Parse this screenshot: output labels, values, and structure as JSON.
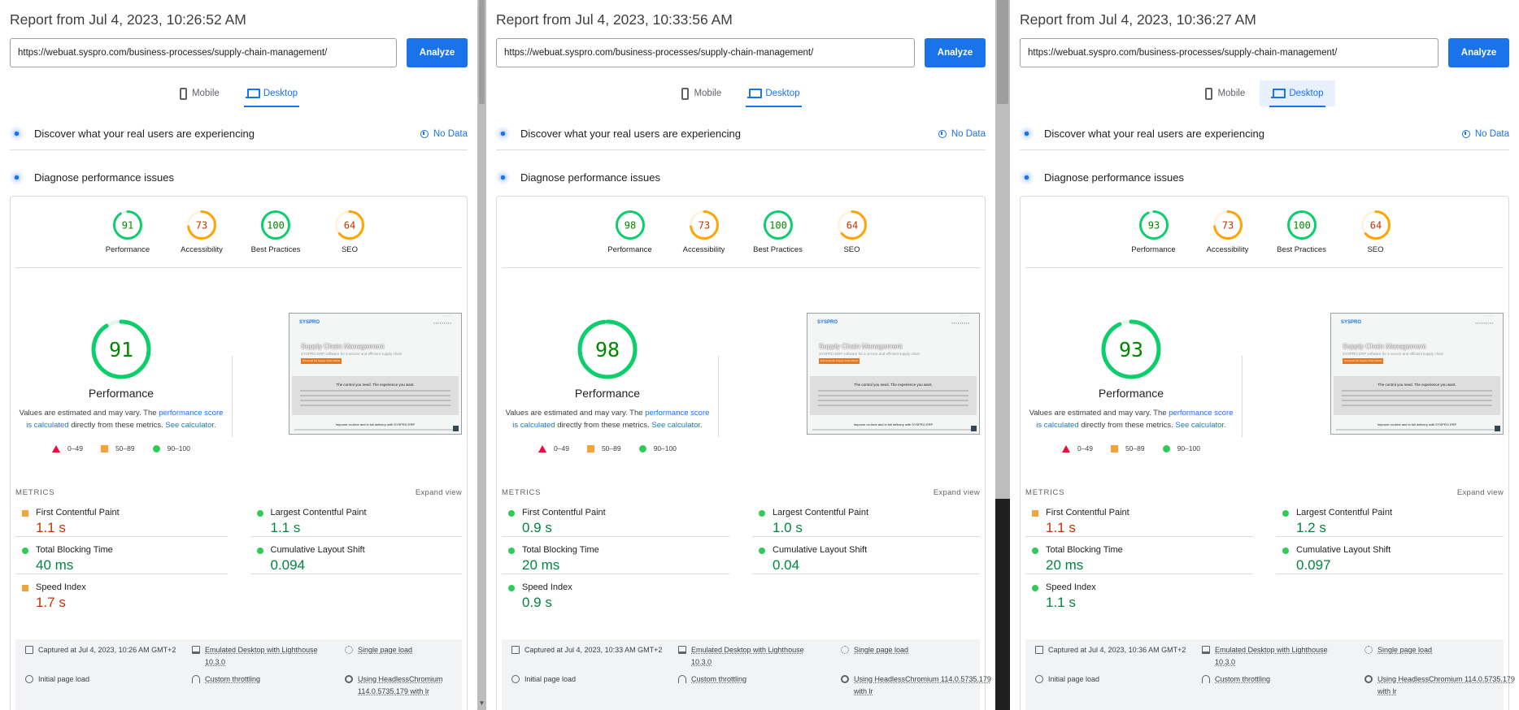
{
  "shared": {
    "analyze_label": "Analyze",
    "tab_mobile": "Mobile",
    "tab_desktop": "Desktop",
    "discover_label": "Discover what your real users are experiencing",
    "no_data_label": "No Data",
    "diagnose_label": "Diagnose performance issues",
    "cat_performance": "Performance",
    "cat_accessibility": "Accessibility",
    "cat_best_practices": "Best Practices",
    "cat_seo": "SEO",
    "big_label": "Performance",
    "note_prefix": "Values are estimated and may vary. The ",
    "note_link": "performance score is calculated",
    "note_middle": " directly from these metrics. ",
    "note_calc": "See calculator.",
    "legend_bad": "0–49",
    "legend_avg": "50–89",
    "legend_good": "90–100",
    "metrics_heading": "METRICS",
    "expand_view": "Expand view",
    "metric_names": {
      "fcp": "First Contentful Paint",
      "lcp": "Largest Contentful Paint",
      "tbt": "Total Blocking Time",
      "cls": "Cumulative Layout Shift",
      "si": "Speed Index"
    },
    "footer": {
      "emulated": "Emulated Desktop with Lighthouse 10.3.0",
      "single": "Single page load",
      "initial": "Initial page load",
      "throttling": "Custom throttling",
      "chromium": "Using HeadlessChromium 114.0.5735.179 with lr"
    },
    "thumb": {
      "logo": "SYSPRO",
      "heading": "Supply Chain Management",
      "sub": "SYSPRO ERP software for a secure and efficient supply chain",
      "cta": "Download the Supply Chain eBook",
      "gray_title": "The control you need. The experience you want.",
      "foot": "Improve on-time and in full delivery with SYSPRO ERP"
    },
    "colors": {
      "good": "#0cce6b",
      "average": "#ffa400",
      "poor": "#ff4e42",
      "accent": "#1a73e8"
    }
  },
  "panels": [
    {
      "title": "Report from Jul 4, 2023, 10:26:52 AM",
      "url": "https://webuat.syspro.com/business-processes/supply-chain-management/",
      "scores": {
        "performance": "91",
        "accessibility": "73",
        "best_practices": "100",
        "seo": "64"
      },
      "metrics": {
        "fcp": "1.1 s",
        "lcp": "1.1 s",
        "tbt": "40 ms",
        "cls": "0.094",
        "si": "1.7 s"
      },
      "captured": "Captured at Jul 4, 2023, 10:26 AM GMT+2"
    },
    {
      "title": "Report from Jul 4, 2023, 10:33:56 AM",
      "url": "https://webuat.syspro.com/business-processes/supply-chain-management/",
      "scores": {
        "performance": "98",
        "accessibility": "73",
        "best_practices": "100",
        "seo": "64"
      },
      "metrics": {
        "fcp": "0.9 s",
        "lcp": "1.0 s",
        "tbt": "20 ms",
        "cls": "0.04",
        "si": "0.9 s"
      },
      "captured": "Captured at Jul 4, 2023, 10:33 AM GMT+2"
    },
    {
      "title": "Report from Jul 4, 2023, 10:36:27 AM",
      "url": "https://webuat.syspro.com/business-processes/supply-chain-management/",
      "scores": {
        "performance": "93",
        "accessibility": "73",
        "best_practices": "100",
        "seo": "64"
      },
      "metrics": {
        "fcp": "1.1 s",
        "lcp": "1.2 s",
        "tbt": "20 ms",
        "cls": "0.097",
        "si": "1.1 s"
      },
      "captured": "Captured at Jul 4, 2023, 10:36 AM GMT+2"
    }
  ]
}
